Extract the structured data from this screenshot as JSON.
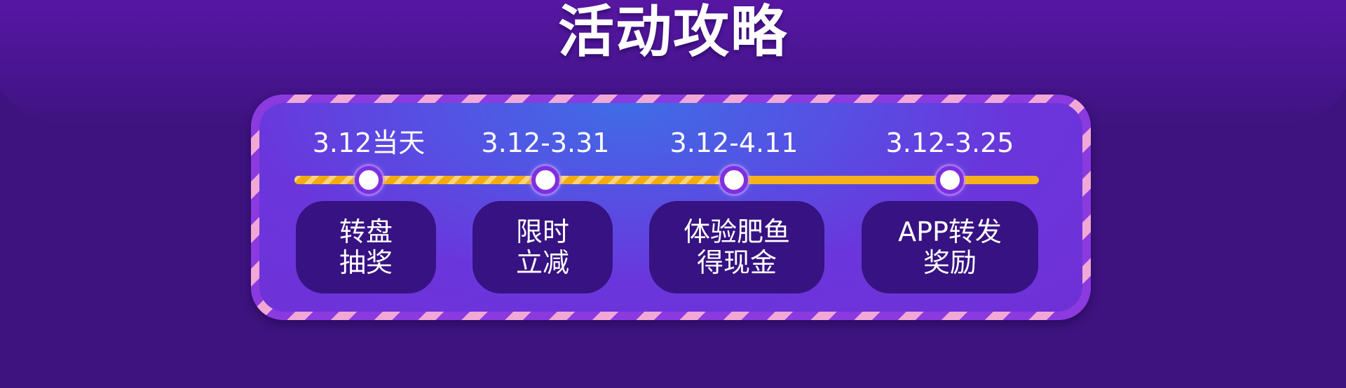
{
  "page": {
    "title": "活动攻略"
  },
  "timeline": {
    "steps": [
      {
        "date": "3.12当天",
        "line1": "转盘",
        "line2": "抽奖"
      },
      {
        "date": "3.12-3.31",
        "line1": "限时",
        "line2": "立减"
      },
      {
        "date": "3.12-4.11",
        "line1": "体验肥鱼",
        "line2": "得现金"
      },
      {
        "date": "3.12-3.25",
        "line1": "APP转发",
        "line2": "奖励"
      }
    ]
  },
  "colors": {
    "background": "#3e137f",
    "timeline": "#f6b21b",
    "card": "#371282",
    "frame_stripe_pink": "#f1a8d6",
    "frame_stripe_purple": "#8b3ae0"
  }
}
